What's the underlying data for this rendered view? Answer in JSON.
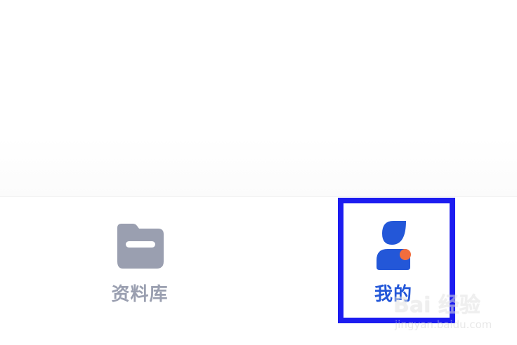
{
  "tabbar": {
    "tabs": [
      {
        "label": "资料库",
        "icon": "folder-icon",
        "selected": false
      },
      {
        "label": "我的",
        "icon": "user-icon",
        "selected": true
      }
    ]
  },
  "colors": {
    "inactive": "#9a9fb0",
    "active": "#2357d8",
    "badge": "#f26d3d",
    "highlight": "#1c1cf0"
  },
  "watermark": {
    "brand": "Bai 经验",
    "url": "jingyan.baidu.com"
  }
}
